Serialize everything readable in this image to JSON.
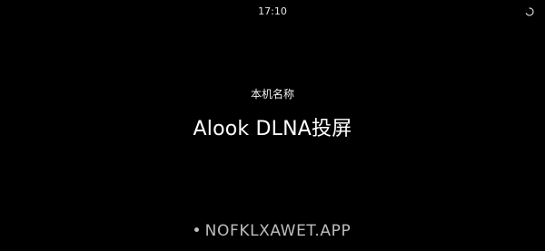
{
  "status_bar": {
    "time": "17:10",
    "loading_icon": "loading-spinner-icon"
  },
  "main": {
    "device_name_label": "本机名称",
    "device_name": "Alook DLNA投屏"
  },
  "watermark": {
    "text": "NOFKLXAWET.APP"
  },
  "colors": {
    "background": "#000000",
    "text": "#ffffff",
    "watermark": "#bdbdbd"
  }
}
